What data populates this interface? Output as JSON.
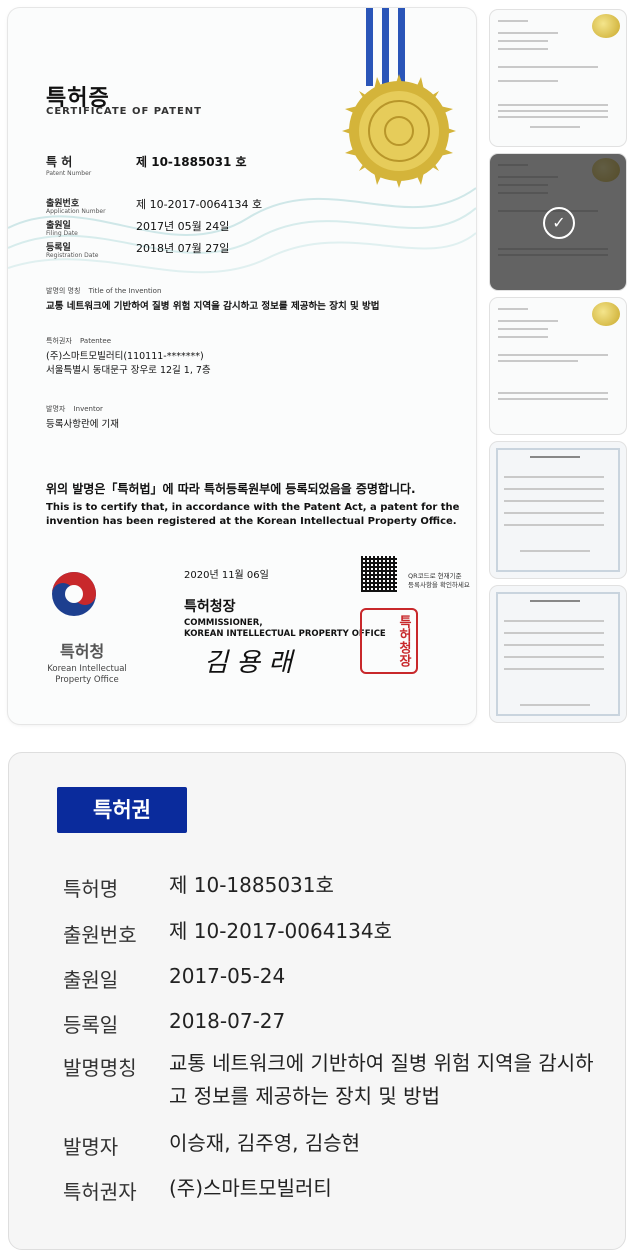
{
  "certificate": {
    "title_ko": "특허증",
    "title_en": "CERTIFICATE OF PATENT",
    "patent_number_label_ko": "특 허",
    "patent_number_label_en": "Patent Number",
    "patent_number_value": "제 10-1885031 호",
    "application_number_label_ko": "출원번호",
    "application_number_label_en": "Application Number",
    "application_number_value": "제 10-2017-0064134 호",
    "filing_date_label_ko": "출원일",
    "filing_date_label_en": "Filing Date",
    "filing_date_value": "2017년 05월 24일",
    "registration_date_label_ko": "등록일",
    "registration_date_label_en": "Registration Date",
    "registration_date_value": "2018년 07월 27일",
    "invention_title_label_ko": "발명의 명칭",
    "invention_title_label_en": "Title of the Invention",
    "invention_title_value": "교통 네트워크에 기반하여 질병 위험 지역을 감시하고 정보를 제공하는 장치 및 방법",
    "patentee_label_ko": "특허권자",
    "patentee_label_en": "Patentee",
    "patentee_value_line1": "(주)스마트모빌러티(110111-*******)",
    "patentee_value_line2": "서울특별시 동대문구 장우로 12길 1, 7층",
    "inventor_label_ko": "발명자",
    "inventor_label_en": "Inventor",
    "inventor_value": "등록사항란에 기재",
    "statement_ko": "위의 발명은「특허법」에 따라 특허등록원부에 등록되었음을 증명합니다.",
    "statement_en_line1": "This is to certify that, in accordance with the Patent Act, a patent for the",
    "statement_en_line2": "invention has been registered at the Korean Intellectual Property Office.",
    "issue_date": "2020년 11월 06일",
    "qr_note_line1": "QR코드로 현재기준",
    "qr_note_line2": "등록사항을 확인하세요",
    "commissioner_ko": "특허청장",
    "commissioner_en_line1": "COMMISSIONER,",
    "commissioner_en_line2": "KOREAN INTELLECTUAL PROPERTY OFFICE",
    "signature": "김 용 래",
    "office_name_ko": "특허청",
    "office_name_en_line1": "Korean Intellectual",
    "office_name_en_line2": "Property Office",
    "stamp_text": "특허청장"
  },
  "thumbnails": [
    {
      "kind": "patent",
      "selected": false
    },
    {
      "kind": "patent",
      "selected": true
    },
    {
      "kind": "patent",
      "selected": false
    },
    {
      "kind": "copyright",
      "selected": false
    },
    {
      "kind": "copyright",
      "selected": false
    }
  ],
  "info": {
    "badge": "특허권",
    "rows": [
      {
        "label": "특허명",
        "value": "제 10-1885031호"
      },
      {
        "label": "출원번호",
        "value": "제 10-2017-0064134호"
      },
      {
        "label": "출원일",
        "value": "2017-05-24"
      },
      {
        "label": "등록일",
        "value": "2018-07-27"
      },
      {
        "label": "발명명칭",
        "value": "교통 네트워크에 기반하여 질병 위험 지역을 감시하고 정보를 제공하는 장치 및 방법"
      },
      {
        "label": "발명자",
        "value": "이승재, 김주영, 김승현"
      },
      {
        "label": "특허권자",
        "value": "(주)스마트모빌러티"
      }
    ]
  },
  "colors": {
    "badge_bg": "#0a2b9c",
    "ribbon": "#2a55b8",
    "seal_gold": "#d4b43a",
    "stamp_red": "#c8282b",
    "kipo_blue": "#1d3f8f",
    "kipo_red": "#c8282b"
  }
}
